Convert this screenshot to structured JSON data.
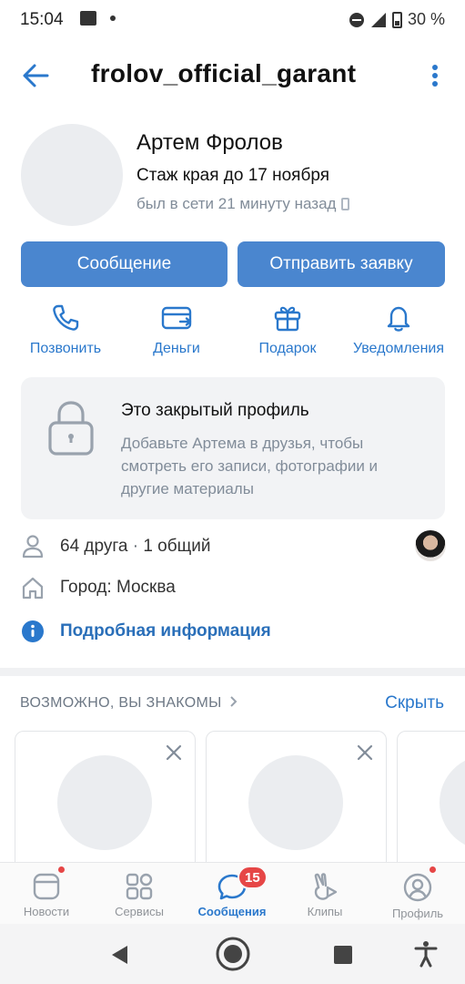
{
  "status_bar": {
    "time": "15:04",
    "battery": "30 %",
    "icons": [
      "gallery-icon",
      "notification-dot-icon",
      "dnd-icon",
      "signal-icon",
      "battery-icon"
    ]
  },
  "header": {
    "title": "frolov_official_garant"
  },
  "profile": {
    "name": "Артем Фролов",
    "status": "Стаж края до 17 ноября",
    "online": "был в сети 21 минуту назад"
  },
  "buttons": {
    "message": "Сообщение",
    "request": "Отправить заявку"
  },
  "actions": [
    {
      "label": "Позвонить",
      "icon": "phone-icon"
    },
    {
      "label": "Деньги",
      "icon": "money-card-icon"
    },
    {
      "label": "Подарок",
      "icon": "gift-icon"
    },
    {
      "label": "Уведомления",
      "icon": "bell-icon"
    }
  ],
  "closed_profile": {
    "title": "Это закрытый профиль",
    "text": "Добавьте Артема в друзья, чтобы смотреть его записи, фотографии и другие материалы"
  },
  "info": {
    "friends": "64 друга",
    "sep": " · ",
    "mutual": "1 общий",
    "city": "Город: Москва",
    "more": "Подробная информация"
  },
  "suggestions": {
    "title": "ВОЗМОЖНО, ВЫ ЗНАКОМЫ",
    "hide": "Скрыть"
  },
  "bottom_nav": {
    "tabs": [
      {
        "label": "Новости",
        "icon": "news-icon",
        "dot": true
      },
      {
        "label": "Сервисы",
        "icon": "services-icon",
        "dot": false
      },
      {
        "label": "Сообщения",
        "icon": "messages-icon",
        "active": true
      },
      {
        "label": "Клипы",
        "icon": "clips-icon",
        "dot": false
      },
      {
        "label": "Профиль",
        "icon": "profile-icon",
        "dot": true
      }
    ],
    "messages_badge": "15"
  },
  "colors": {
    "accent": "#2a78cc",
    "button": "#4a86cf",
    "muted": "#818c99",
    "badge": "#e64646"
  }
}
